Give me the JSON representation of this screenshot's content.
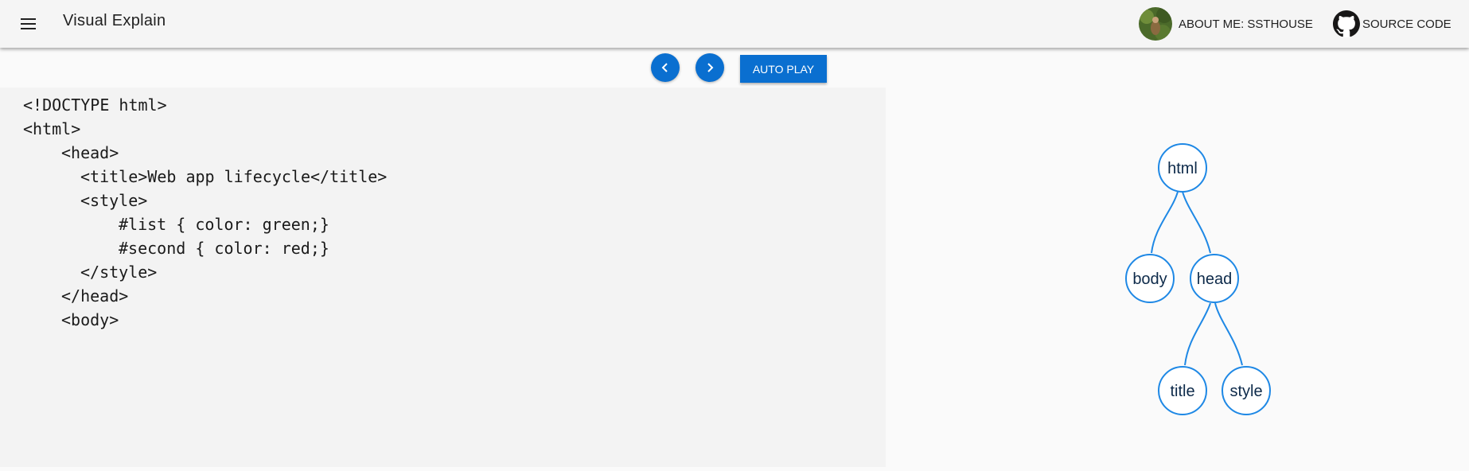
{
  "header": {
    "title": "Visual Explain",
    "about_label": "ABOUT ME: SSTHOUSE",
    "source_label": "SOURCE CODE"
  },
  "controls": {
    "prev_icon": "chevron-left",
    "next_icon": "chevron-right",
    "autoplay_label": "AUTO PLAY"
  },
  "code": {
    "lines": [
      "<!DOCTYPE html>",
      "<html>",
      "<head>",
      "<title>Web app lifecycle</title>",
      "<style>",
      "#list { color: green;}",
      "#second { color: red;}",
      "</style>",
      "</head>",
      "<body>"
    ]
  },
  "tree": {
    "nodes": [
      "html",
      "body",
      "head",
      "title",
      "style"
    ]
  },
  "colors": {
    "accent": "#0a6fd0",
    "node_stroke": "#1e88e5"
  }
}
